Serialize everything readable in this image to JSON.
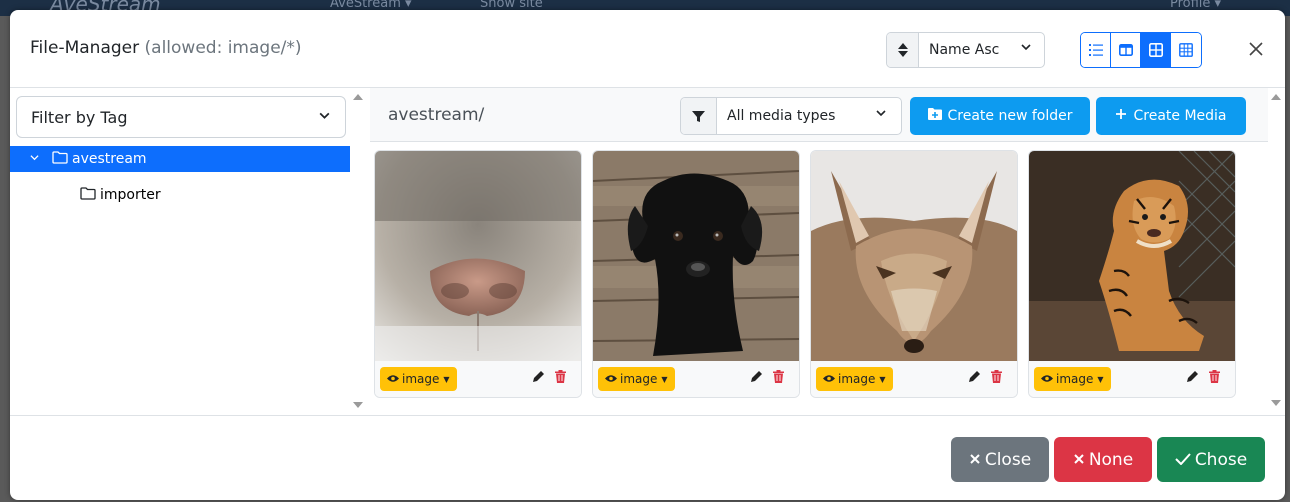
{
  "background_nav": {
    "brand": "AveStream",
    "site_menu": "AveStream ▾",
    "show_site": "Show site",
    "profile": "Profile ▾"
  },
  "header": {
    "title": "File-Manager",
    "allowed": "(allowed: image/*)",
    "sort_icon": "sort-icon",
    "sort_value": "Name Asc",
    "view_modes": [
      {
        "icon": "list-icon",
        "active": false
      },
      {
        "icon": "columns-icon",
        "active": false
      },
      {
        "icon": "grid-large-icon",
        "active": true
      },
      {
        "icon": "grid-small-icon",
        "active": false
      }
    ],
    "close_symbol": "×"
  },
  "sidebar": {
    "tag_filter_placeholder": "Filter by Tag",
    "tree": [
      {
        "label": "avestream",
        "expanded": true,
        "selected": true
      },
      {
        "label": "importer",
        "expanded": false,
        "selected": false
      }
    ]
  },
  "toolbar": {
    "path": "avestream/",
    "media_type_value": "All media types",
    "create_folder_label": "Create new folder",
    "create_media_label": "Create Media"
  },
  "media": [
    {
      "type_label": "image",
      "thumb": "cat-nose-photo"
    },
    {
      "type_label": "image",
      "thumb": "black-puppy-photo"
    },
    {
      "type_label": "image",
      "thumb": "coyote-photo"
    },
    {
      "type_label": "image",
      "thumb": "tiger-cub-photo"
    }
  ],
  "footer": {
    "close_label": "Close",
    "none_label": "None",
    "chose_label": "Chose"
  },
  "colors": {
    "primary": "#0d6efd",
    "info": "#0d9bf0",
    "warning": "#ffc107",
    "danger": "#dc3545",
    "success": "#198754",
    "secondary": "#6c757d"
  }
}
